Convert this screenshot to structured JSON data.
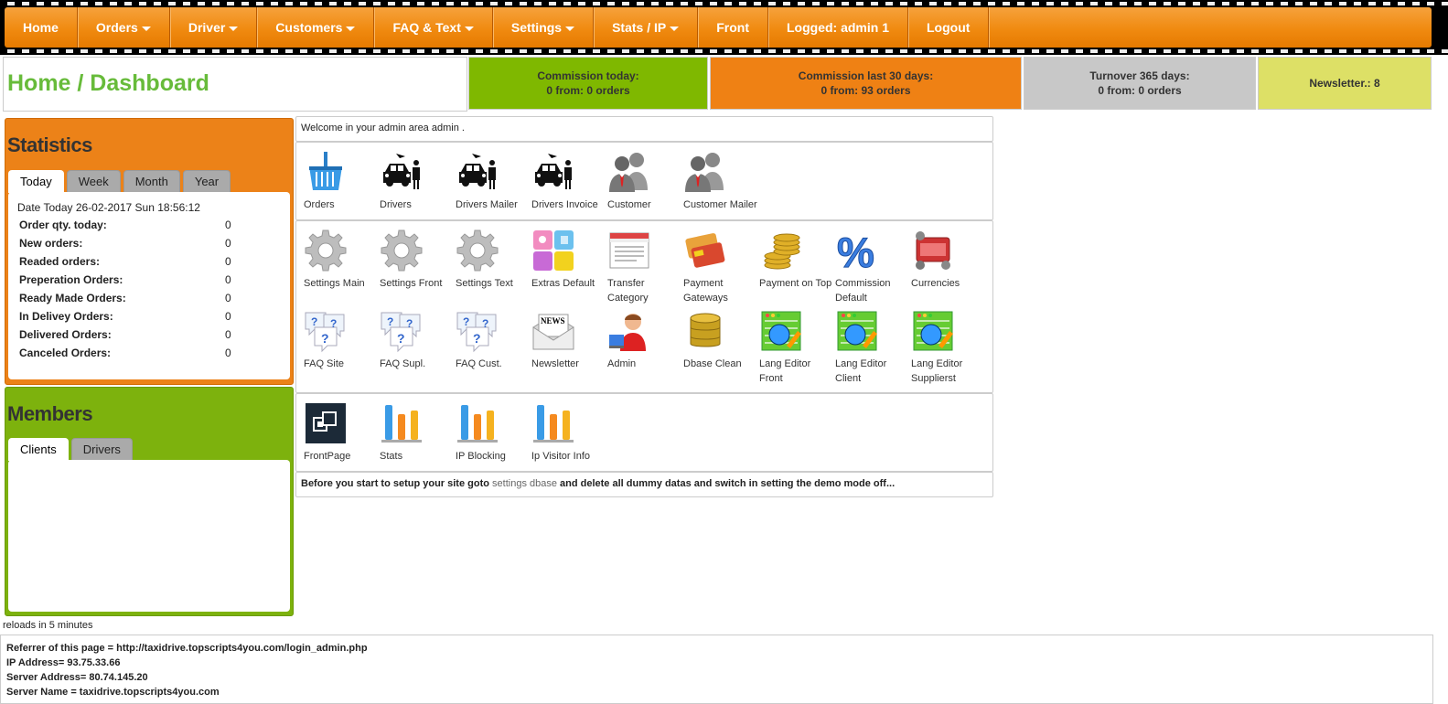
{
  "nav": {
    "items": [
      {
        "label": "Home",
        "caret": false
      },
      {
        "label": "Orders",
        "caret": true
      },
      {
        "label": "Driver",
        "caret": true
      },
      {
        "label": "Customers",
        "caret": true
      },
      {
        "label": "FAQ & Text",
        "caret": true
      },
      {
        "label": "Settings",
        "caret": true
      },
      {
        "label": "Stats / IP",
        "caret": true
      },
      {
        "label": "Front",
        "caret": false
      },
      {
        "label": "Logged: admin 1",
        "caret": false
      },
      {
        "label": "Logout",
        "caret": false
      }
    ],
    "color": "#f08a10"
  },
  "header": {
    "title": "Home / Dashboard",
    "commission_today": {
      "line1": "Commission today:",
      "line2": "0 from: 0 orders",
      "color": "#7fb800"
    },
    "commission_30": {
      "line1": "Commission last 30 days:",
      "line2": "0 from: 93 orders",
      "color": "#ef8114"
    },
    "turnover": {
      "line1": "Turnover 365 days:",
      "line2": "0 from: 0 orders",
      "color": "#c8c8c8"
    },
    "newsletter": {
      "line1": "Newsletter.: 8",
      "color": "#dde066"
    }
  },
  "statistics": {
    "title": "Statistics",
    "tabs": [
      "Today",
      "Week",
      "Month",
      "Year"
    ],
    "date_line": "Date Today 26-02-2017 Sun 18:56:12",
    "rows": [
      {
        "label": "Order qty. today:",
        "value": "0"
      },
      {
        "label": "New orders:",
        "value": "0"
      },
      {
        "label": "Readed orders:",
        "value": "0"
      },
      {
        "label": "Preperation Orders:",
        "value": "0"
      },
      {
        "label": "Ready Made Orders:",
        "value": "0"
      },
      {
        "label": "In Delivey Orders:",
        "value": "0"
      },
      {
        "label": "Delivered Orders:",
        "value": "0"
      },
      {
        "label": "Canceled Orders:",
        "value": "0"
      }
    ]
  },
  "members": {
    "title": "Members",
    "tabs": [
      "Clients",
      "Drivers"
    ]
  },
  "welcome": "Welcome in your admin area admin .",
  "group1": [
    {
      "label": "Orders",
      "icon": "basket-icon"
    },
    {
      "label": "Drivers",
      "icon": "taxi-driver-icon"
    },
    {
      "label": "Drivers Mailer",
      "icon": "taxi-driver-icon"
    },
    {
      "label": "Drivers Invoice",
      "icon": "taxi-driver-icon"
    },
    {
      "label": "Customer",
      "icon": "customers-icon"
    },
    {
      "label": "Customer Mailer",
      "icon": "customers-icon"
    }
  ],
  "group2": [
    {
      "label": "Settings Main",
      "icon": "gear-icon"
    },
    {
      "label": "Settings Front",
      "icon": "gear-icon"
    },
    {
      "label": "Settings Text",
      "icon": "gear-icon"
    },
    {
      "label": "Extras Default",
      "icon": "extras-tiles-icon"
    },
    {
      "label": "Transfer Category",
      "icon": "window-icon"
    },
    {
      "label": "Payment Gateways",
      "icon": "credit-cards-icon"
    },
    {
      "label": "Payment on Top",
      "icon": "coins-icon"
    },
    {
      "label": "Commission Default",
      "icon": "percent-icon"
    },
    {
      "label": "Currencies",
      "icon": "currencies-icon"
    },
    {
      "label": "FAQ Site",
      "icon": "faq-bubbles-icon"
    },
    {
      "label": "FAQ Supl.",
      "icon": "faq-bubbles-icon"
    },
    {
      "label": "FAQ Cust.",
      "icon": "faq-bubbles-icon"
    },
    {
      "label": "Newsletter",
      "icon": "newsletter-icon"
    },
    {
      "label": "Admin",
      "icon": "admin-user-icon"
    },
    {
      "label": "Dbase Clean",
      "icon": "database-icon"
    },
    {
      "label": "Lang Editor Front",
      "icon": "lang-editor-icon"
    },
    {
      "label": "Lang Editor Client",
      "icon": "lang-editor-icon"
    },
    {
      "label": "Lang Editor Supplierst",
      "icon": "lang-editor-icon"
    }
  ],
  "group3": [
    {
      "label": "FrontPage",
      "icon": "frontpage-icon"
    },
    {
      "label": "Stats",
      "icon": "bar-chart-icon"
    },
    {
      "label": "IP Blocking",
      "icon": "bar-chart-icon"
    },
    {
      "label": "Ip Visitor Info",
      "icon": "bar-chart-icon"
    }
  ],
  "notice": {
    "before": "Before you start to setup your site goto ",
    "link": "settings dbase",
    "after": " and delete all dummy datas and switch in setting the demo mode off..."
  },
  "reload_note": "reloads in 5 minutes",
  "info": [
    "Referrer of this page = http://taxidrive.topscripts4you.com/login_admin.php",
    "IP Address= 93.75.33.66",
    "Server Address= 80.74.145.20",
    "Server Name = taxidrive.topscripts4you.com"
  ]
}
